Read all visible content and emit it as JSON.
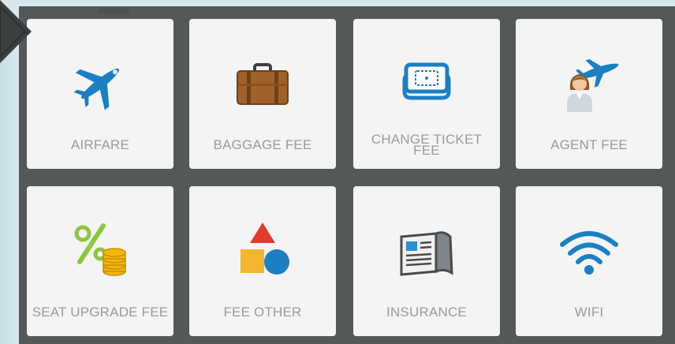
{
  "tiles": [
    {
      "label": "AIRFARE",
      "icon": "airplane-icon"
    },
    {
      "label": "BAGGAGE FEE",
      "icon": "suitcase-icon"
    },
    {
      "label": "CHANGE TICKET FEE",
      "icon": "ticket-icon"
    },
    {
      "label": "AGENT FEE",
      "icon": "agent-icon"
    },
    {
      "label": "SEAT UPGRADE FEE",
      "icon": "percent-coins-icon"
    },
    {
      "label": "FEE OTHER",
      "icon": "shapes-icon"
    },
    {
      "label": "INSURANCE",
      "icon": "document-icon"
    },
    {
      "label": "WIFI",
      "icon": "wifi-icon"
    }
  ],
  "colors": {
    "panel": "#545859",
    "tile": "#f4f4f4",
    "label": "#9a9a9a",
    "accent_blue": "#1b7fc2",
    "suitcase": "#a0622a"
  }
}
